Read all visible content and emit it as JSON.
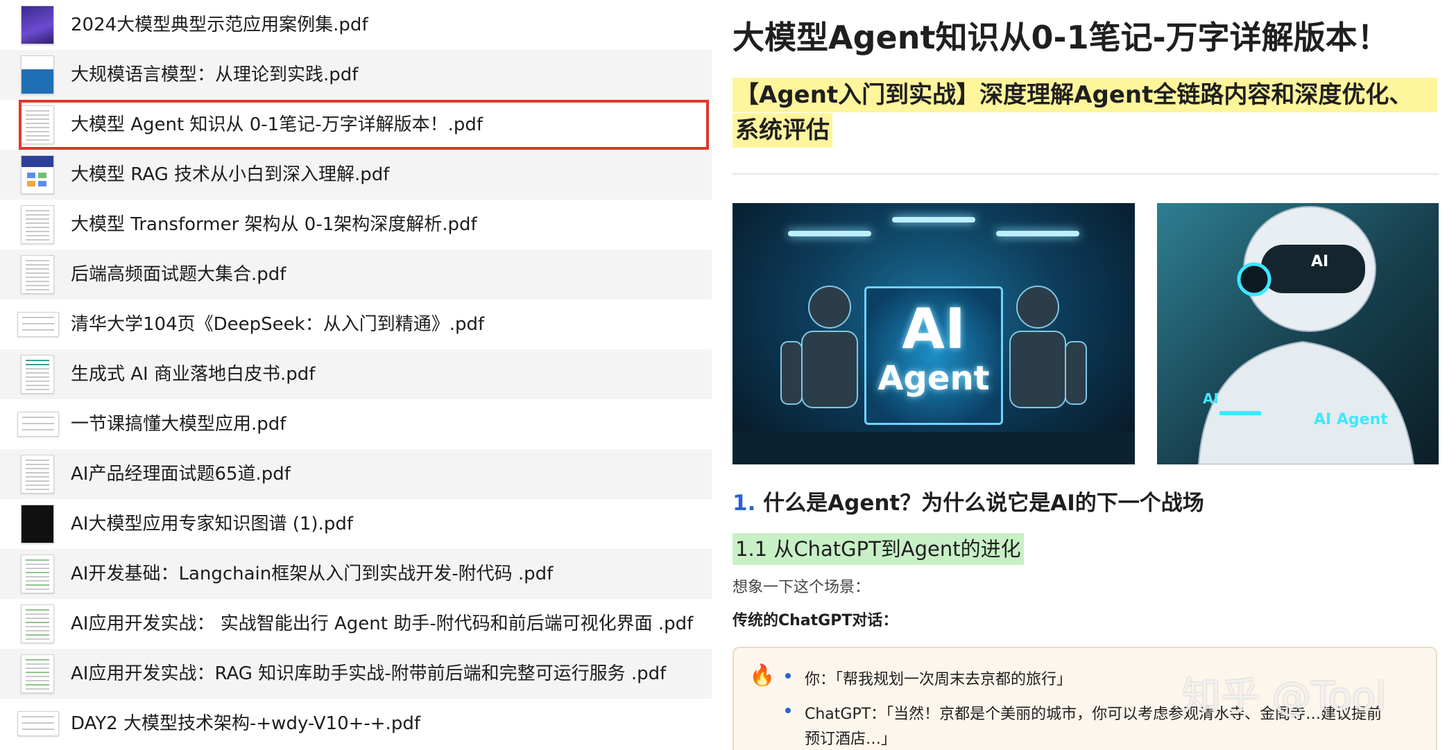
{
  "file_list": [
    {
      "name": "2024大模型典型示范应用案例集.pdf",
      "thumb": "cover-purple"
    },
    {
      "name": "大规模语言模型：从理论到实践.pdf",
      "thumb": "cover-blue"
    },
    {
      "name": "大模型 Agent 知识从 0-1笔记-万字详解版本！.pdf",
      "thumb": "doc",
      "selected": true
    },
    {
      "name": "大模型 RAG 技术从小白到深入理解.pdf",
      "thumb": "cover-rag"
    },
    {
      "name": "大模型 Transformer 架构从 0-1架构深度解析.pdf",
      "thumb": "doc"
    },
    {
      "name": "后端高频面试题大集合.pdf",
      "thumb": "doc"
    },
    {
      "name": "清华大学104页《DeepSeek：从入门到精通》.pdf",
      "thumb": "landscape"
    },
    {
      "name": "生成式 AI 商业落地白皮书.pdf",
      "thumb": "doc-teal"
    },
    {
      "name": "一节课搞懂大模型应用.pdf",
      "thumb": "landscape"
    },
    {
      "name": "AI产品经理面试题65道.pdf",
      "thumb": "doc"
    },
    {
      "name": "AI大模型应用专家知识图谱 (1).pdf",
      "thumb": "cover-dark"
    },
    {
      "name": "AI开发基础：Langchain框架从入门到实战开发-附代码 .pdf",
      "thumb": "doc-green"
    },
    {
      "name": "AI应用开发实战：  实战智能出行 Agent 助手-附代码和前后端可视化界面 .pdf",
      "thumb": "doc-green"
    },
    {
      "name": "AI应用开发实战：RAG 知识库助手实战-附带前后端和完整可运行服务 .pdf",
      "thumb": "doc-green"
    },
    {
      "name": "DAY2 大模型技术架构-+wdy-V10+-+.pdf",
      "thumb": "landscape"
    }
  ],
  "article": {
    "title": "大模型Agent知识从0-1笔记-万字详解版本！",
    "subtitle_line1": "【Agent入门到实战】深度理解Agent全链路内容和深度优化、",
    "subtitle_line2": "系统评估",
    "hero_image_1": {
      "big_text": "AI",
      "small_text": "Agent"
    },
    "hero_image_2": {
      "helmet_text": "AI",
      "chest_text": "AI Agent",
      "arm_text": "AI"
    },
    "section_1": {
      "number": "1.",
      "text": "什么是Agent？为什么说它是AI的下一个战场"
    },
    "section_1_1": "1.1 从ChatGPT到Agent的进化",
    "scene_intro": "想象一下这个场景：",
    "chatgpt_label": "传统的ChatGPT对话：",
    "dialog": {
      "icon": "🔥",
      "line1": "你：「帮我规划一次周末去京都的旅行」",
      "line2": "ChatGPT：「当然！京都是个美丽的城市，你可以考虑参观清水寺、金阁寺…建议提前",
      "line3": "预订酒店…」"
    }
  },
  "watermark": "知乎 @Tool",
  "colors": {
    "selection": "#e3352a",
    "highlight_yellow": "#fff59d",
    "highlight_green": "#c8f0c6",
    "link_blue": "#2962d9"
  }
}
